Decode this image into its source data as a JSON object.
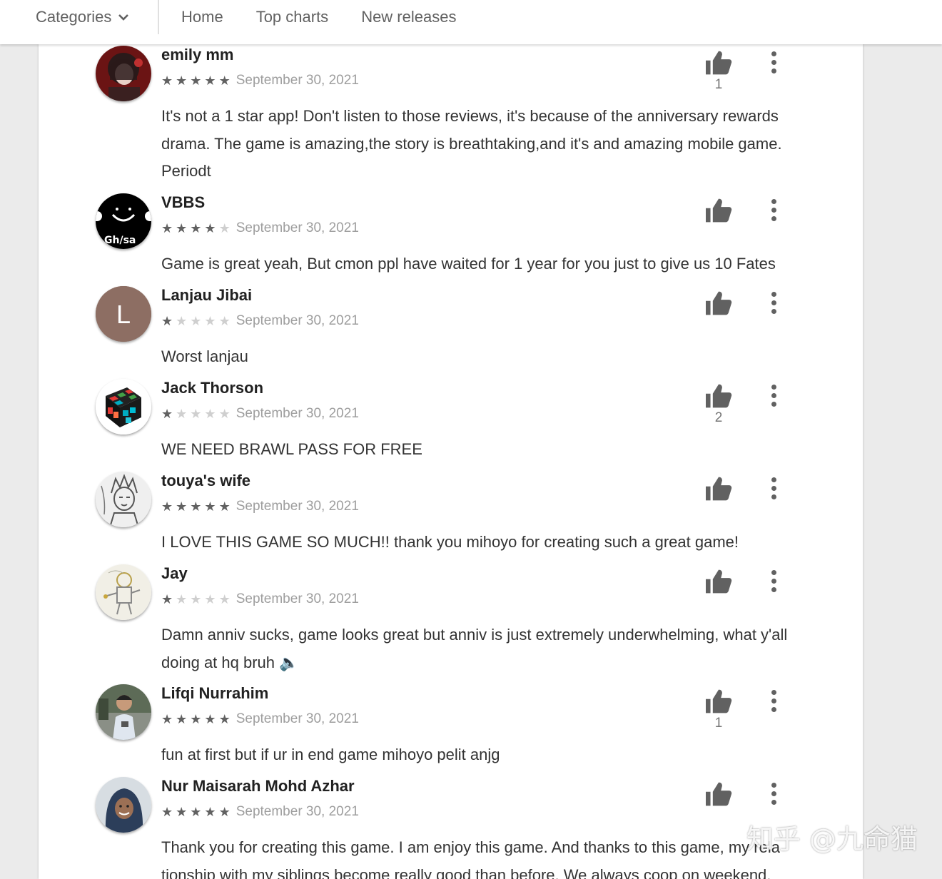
{
  "topbar": {
    "categories_label": "Categories",
    "nav": [
      "Home",
      "Top charts",
      "New releases"
    ]
  },
  "colors": {
    "star_on": "#616161",
    "star_off": "#cfcfcf",
    "avatar_l_bg": "#8d6e63"
  },
  "reviews": [
    {
      "name": "emily mm",
      "rating": 5,
      "date": "September 30, 2021",
      "text": "It's not a 1 star app! Don't listen to those reviews, it's because of the anniversary rewards drama. The game is amazing,the story is breathtaking,and it's and amazing mobile game. Periodt",
      "likes": "1",
      "avatar": "anime-photo"
    },
    {
      "name": "VBBS",
      "rating": 4,
      "date": "September 30, 2021",
      "text": "Game is great yeah, But cmon ppl have waited for 1 year for you just to give us 10 Fates",
      "likes": "",
      "avatar": "black-smile-logo",
      "avatar_text": "Gh/sa"
    },
    {
      "name": "Lanjau Jibai",
      "rating": 1,
      "date": "September 30, 2021",
      "text": "Worst lanjau",
      "likes": "",
      "avatar": "letter",
      "avatar_letter": "L"
    },
    {
      "name": "Jack Thorson",
      "rating": 1,
      "date": "September 30, 2021",
      "text": "WE NEED BRAWL PASS FOR FREE",
      "likes": "2",
      "avatar": "rubiks-cube"
    },
    {
      "name": "touya's wife",
      "rating": 5,
      "date": "September 30, 2021",
      "text": "I LOVE THIS GAME SO MUCH!! thank you mihoyo for creating such a great game!",
      "likes": "",
      "avatar": "sketch"
    },
    {
      "name": "Jay",
      "rating": 1,
      "date": "September 30, 2021",
      "text": "Damn anniv sucks, game looks great but anniv is just extremely underwhelming, what y'all doing at hq bruh 🔈",
      "likes": "",
      "avatar": "doodle"
    },
    {
      "name": "Lifqi Nurrahim",
      "rating": 5,
      "date": "September 30, 2021",
      "text": "fun at first but if ur in end game mihoyo pelit anjg",
      "likes": "1",
      "avatar": "person-photo"
    },
    {
      "name": "Nur Maisarah Mohd Azhar",
      "rating": 5,
      "date": "September 30, 2021",
      "text": "Thank you for creating this game. I am enjoy this game. And thanks to this game, my rela tionship with my siblings become really good than before. We always coop on weekend.",
      "likes": "",
      "avatar": "hijab-photo"
    }
  ],
  "watermark": "知乎 @九命猫"
}
